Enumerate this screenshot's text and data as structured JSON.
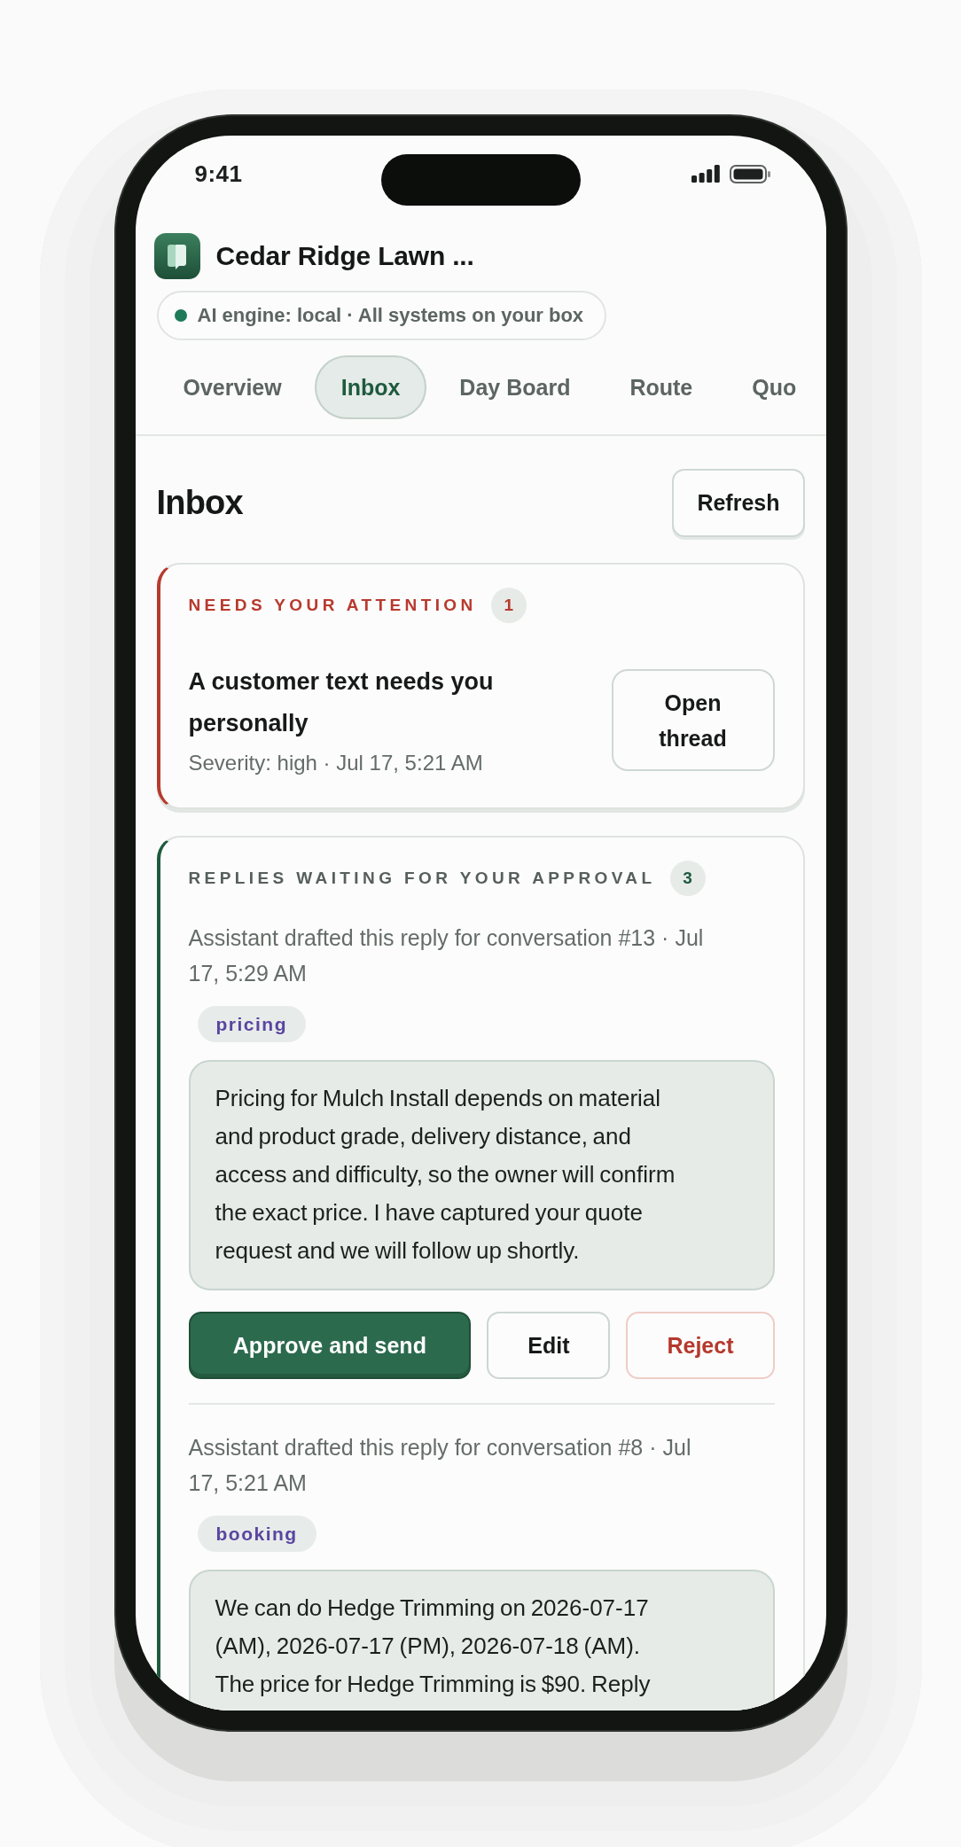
{
  "status_bar": {
    "time": "9:41"
  },
  "header": {
    "title": "Cedar Ridge Lawn ...",
    "engine": {
      "label": "AI engine: local · All systems on your box",
      "healthy": true
    }
  },
  "tabs": [
    {
      "label": "Overview",
      "selected": false
    },
    {
      "label": "Inbox",
      "selected": true
    },
    {
      "label": "Day Board",
      "selected": false
    },
    {
      "label": "Route",
      "selected": false
    },
    {
      "label": "Quo",
      "selected": false
    }
  ],
  "page": {
    "title": "Inbox",
    "refresh_button": "Refresh"
  },
  "sections": [
    {
      "kind": "attention",
      "title": "NEEDS YOUR ATTENTION",
      "count": "1",
      "items": [
        {
          "title": "A customer text needs you personally",
          "meta": "Severity: high · Jul 17, 5:21 AM",
          "button": "Open thread"
        }
      ]
    },
    {
      "kind": "approval",
      "title": "REPLIES WAITING FOR YOUR APPROVAL",
      "count": "3",
      "drafts": [
        {
          "meta": "Assistant drafted this reply for conversation #13 · Jul 17, 5:29 AM",
          "tag": "pricing",
          "reply": "Pricing for Mulch Install depends on material and product grade, delivery distance, and access and difficulty, so the owner will confirm the exact price. I have captured your quote request and we will follow up shortly.",
          "actions": [
            {
              "label": "Approve and send",
              "kind": "primary"
            },
            {
              "label": "Edit",
              "kind": "secondary"
            },
            {
              "label": "Reject",
              "kind": "danger"
            }
          ]
        },
        {
          "meta": "Assistant drafted this reply for conversation #8 · Jul 17, 5:21 AM",
          "tag": "booking",
          "reply": "We can do Hedge Trimming on 2026-07-17 (AM), 2026-07-17 (PM), 2026-07-18 (AM). The price for Hedge Trimming is $90. Reply"
        }
      ]
    }
  ]
}
